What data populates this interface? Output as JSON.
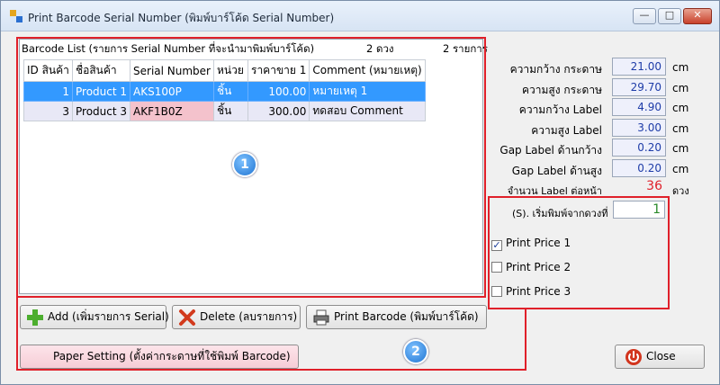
{
  "window": {
    "title": "Print Barcode Serial Number (พิมพ์บาร์โค้ด Serial Number)",
    "controls": [
      "minimize",
      "maximize",
      "close"
    ]
  },
  "list": {
    "caption": "Barcode List (รายการ Serial Number ที่จะนำมาพิมพ์บาร์โค้ด)",
    "count_labels": "2 ดวง",
    "count_items": "2 รายการ",
    "columns": [
      "ID สินค้า",
      "ชื่อสินค้า",
      "Serial Number",
      "หน่วย",
      "ราคาขาย 1",
      "Comment  (หมายเหตุ)"
    ],
    "rows": [
      {
        "id": "1",
        "name": "Product 1",
        "serial": "AKS100P",
        "unit": "ชิ้น",
        "price": "100.00",
        "comment": "หมายเหตุ 1"
      },
      {
        "id": "3",
        "name": "Product 3",
        "serial": "AKF1B0Z",
        "unit": "ชิ้น",
        "price": "300.00",
        "comment": "ทดสอบ Comment"
      }
    ]
  },
  "buttons": {
    "add": "Add (เพิ่มรายการ Serial)",
    "delete": "Delete (ลบรายการ)",
    "print": "Print Barcode (พิมพ์บาร์โค้ด)",
    "paper": "Paper Setting (ตั้งค่ากระดาษที่ใช้พิมพ์ Barcode)",
    "close": "Close"
  },
  "params": [
    {
      "label": "ความกว้าง กระดาษ",
      "value": "21.00",
      "unit": "cm"
    },
    {
      "label": "ความสูง กระดาษ",
      "value": "29.70",
      "unit": "cm"
    },
    {
      "label": "ความกว้าง Label",
      "value": "4.90",
      "unit": "cm"
    },
    {
      "label": "ความสูง Label",
      "value": "3.00",
      "unit": "cm"
    },
    {
      "label": "Gap Label ด้านกว้าง",
      "value": "0.20",
      "unit": "cm"
    },
    {
      "label": "Gap Label ด้านสูง",
      "value": "0.20",
      "unit": "cm"
    }
  ],
  "labels_per_page": {
    "label": "จำนวน Label ต่อหน้า",
    "value": "36",
    "unit": "ดวง"
  },
  "start_position": {
    "label": "(S). เริ่มพิมพ์จากดวงที่",
    "value": "1"
  },
  "print_price": [
    {
      "label": "Print Price 1",
      "checked": true
    },
    {
      "label": "Print Price 2",
      "checked": false
    },
    {
      "label": "Print Price 3",
      "checked": false
    }
  ],
  "badges": [
    "1",
    "2"
  ],
  "colors": {
    "highlight_box": "#e0202a",
    "selection": "#3399ff",
    "value_text": "#1e3ca8",
    "labels_count": "#e0202a"
  }
}
